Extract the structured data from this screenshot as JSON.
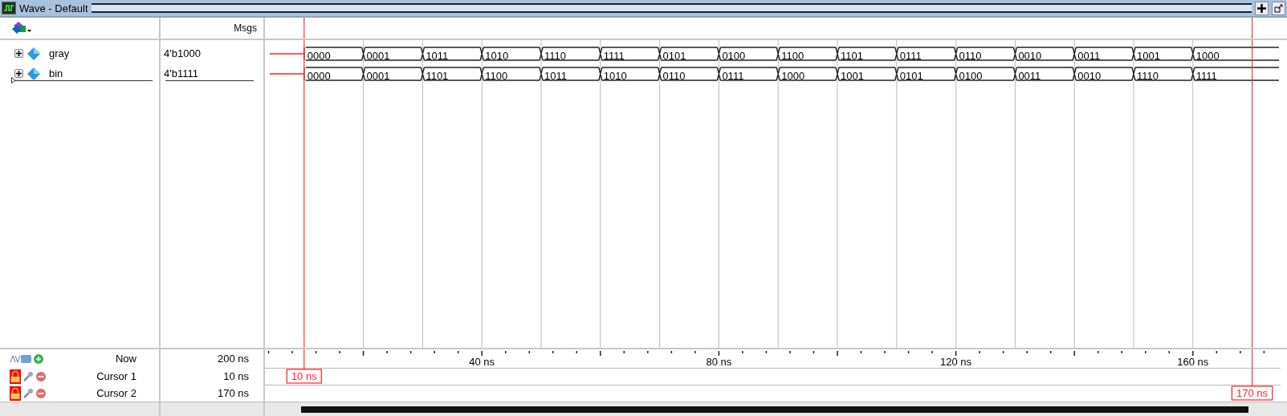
{
  "window": {
    "title": "Wave - Default"
  },
  "header": {
    "msgs": "Msgs"
  },
  "signals": [
    {
      "name": "gray",
      "value": "4'b1000",
      "expanded": false,
      "values": [
        "0000",
        "0001",
        "1011",
        "1010",
        "1110",
        "1111",
        "0101",
        "0100",
        "1100",
        "1101",
        "0111",
        "0110",
        "0010",
        "0011",
        "1001",
        "1000"
      ]
    },
    {
      "name": "bin",
      "value": "4'b1111",
      "expanded": false,
      "values": [
        "0000",
        "0001",
        "1101",
        "1100",
        "1011",
        "1010",
        "0110",
        "0111",
        "1000",
        "1001",
        "0101",
        "0100",
        "0011",
        "0010",
        "1110",
        "1111"
      ]
    }
  ],
  "now": {
    "label": "Now",
    "value": "200 ns"
  },
  "ruler": {
    "labels": [
      "40 ns",
      "80 ns",
      "120 ns",
      "160 ns"
    ]
  },
  "cursors": [
    {
      "name": "Cursor 1",
      "value": "10 ns",
      "marker": "10 ns",
      "locked": true
    },
    {
      "name": "Cursor 2",
      "value": "170 ns",
      "marker": "170 ns",
      "locked": true
    }
  ]
}
